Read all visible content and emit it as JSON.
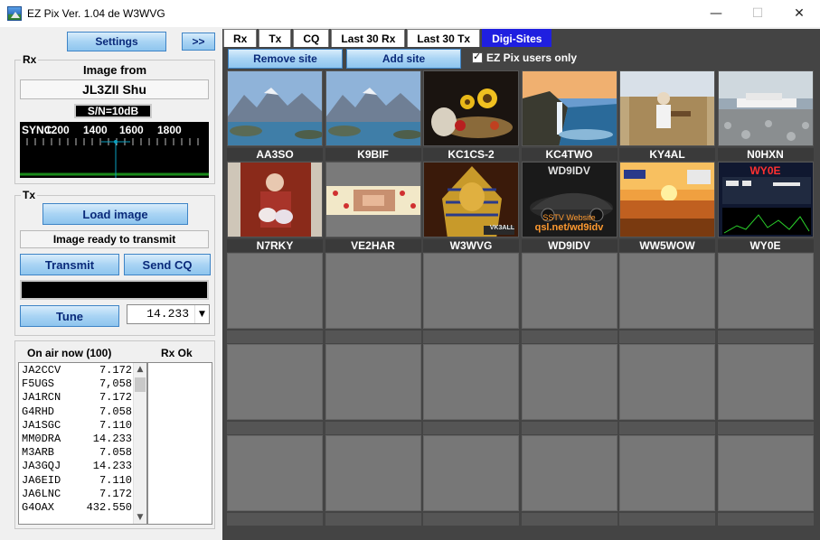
{
  "window": {
    "title": "EZ Pix   Ver. 1.04 de W3WVG",
    "minimize": "—",
    "maximize": "☐",
    "close": "✕"
  },
  "left": {
    "settings_label": "Settings",
    "expand_label": ">>",
    "rx": {
      "group_label": "Rx",
      "image_from_label": "Image from",
      "from_callsign": "JL3ZII  Shu",
      "sn_label": "S/N=10dB",
      "sync_label": "SYNC",
      "freq_ticks": [
        "1200",
        "1400",
        "1600",
        "1800"
      ]
    },
    "tx": {
      "group_label": "Tx",
      "load_image_label": "Load image",
      "status_text": "Image ready to transmit",
      "transmit_label": "Transmit",
      "send_cq_label": "Send CQ",
      "tune_label": "Tune",
      "frequency_value": "14.233"
    },
    "onair": {
      "header": "On air now (100)",
      "rxok_header": "Rx Ok",
      "items": [
        {
          "call": "JA2CCV",
          "freq": "7.172"
        },
        {
          "call": "F5UGS",
          "freq": "7,058"
        },
        {
          "call": "JA1RCN",
          "freq": "7.172"
        },
        {
          "call": "G4RHD",
          "freq": "7.058"
        },
        {
          "call": "JA1SGC",
          "freq": "7.110"
        },
        {
          "call": "MM0DRA",
          "freq": "14.233"
        },
        {
          "call": "M3ARB",
          "freq": "7.058"
        },
        {
          "call": "JA3GQJ",
          "freq": "14.233"
        },
        {
          "call": "JA6EID",
          "freq": "7.110"
        },
        {
          "call": "JA6LNC",
          "freq": "7.172"
        },
        {
          "call": "G4OAX",
          "freq": "432.550"
        }
      ]
    }
  },
  "right": {
    "tabs": [
      {
        "label": "Rx",
        "active": false
      },
      {
        "label": "Tx",
        "active": false
      },
      {
        "label": "CQ",
        "active": false
      },
      {
        "label": "Last 30 Rx",
        "active": false
      },
      {
        "label": "Last 30 Tx",
        "active": false
      },
      {
        "label": "Digi-Sites",
        "active": true
      }
    ],
    "remove_site_label": "Remove site",
    "add_site_label": "Add site",
    "ezpix_only_label": "EZ Pix users only",
    "sites": [
      {
        "call": "AA3SO",
        "thumb": "mountain-lake"
      },
      {
        "call": "K9BIF",
        "thumb": "mountain-lake"
      },
      {
        "call": "KC1CS-2",
        "thumb": "sunflower-still-life"
      },
      {
        "call": "KC4TWO",
        "thumb": "waterfall-coast"
      },
      {
        "call": "KY4AL",
        "thumb": "man-outdoors"
      },
      {
        "call": "N0HXN",
        "thumb": "ship-harbor"
      },
      {
        "call": "N7RKY",
        "thumb": "family-photo"
      },
      {
        "call": "VE2HAR",
        "thumb": "banner-collage"
      },
      {
        "call": "W3WVG",
        "thumb": "pharaoh-mask"
      },
      {
        "call": "WD9IDV",
        "thumb": "sports-car",
        "overlay_top": "WD9IDV",
        "overlay_mid": "SSTV Website",
        "overlay_bottom": "qsl.net/wd9idv"
      },
      {
        "call": "WW5WOW",
        "thumb": "sunset-beach"
      },
      {
        "call": "WY0E",
        "thumb": "spectrum-screen",
        "overlay_top": "WY0E"
      }
    ],
    "vk_mark": "VK3ALL"
  },
  "colors": {
    "panel_dark": "#444444",
    "tab_active": "#1f1fe0",
    "button_text": "#0a2a7a"
  }
}
